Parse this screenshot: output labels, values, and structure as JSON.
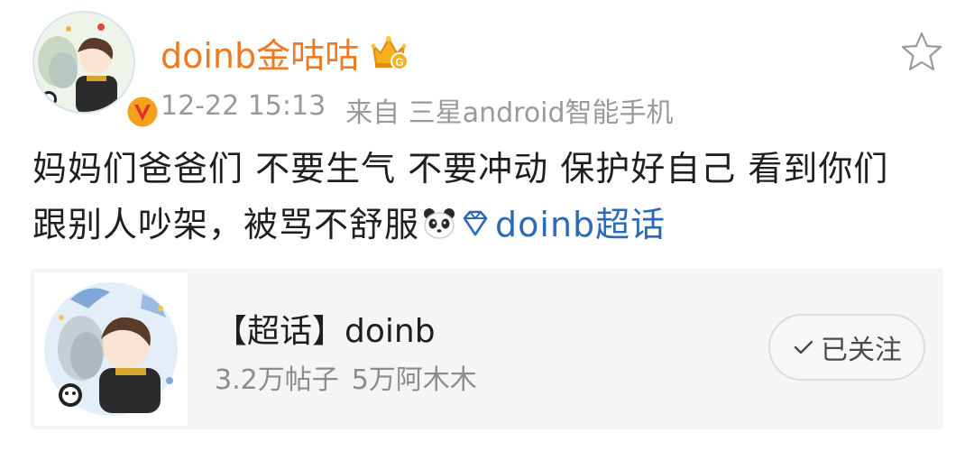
{
  "header": {
    "username": "doinb金咕咕",
    "time": "12-22 15:13",
    "source": "来自 三星android智能手机"
  },
  "post": {
    "line1": "妈妈们爸爸们 不要生气 不要冲动 保护好自己 看到你们",
    "line2": "跟别人吵架，被骂不舒服",
    "topic": "doinb超话"
  },
  "card": {
    "title": "【超话】doinb",
    "posts": "3.2万帖子",
    "followers": "5万阿木木",
    "follow_label": "已关注"
  },
  "colors": {
    "username": "#ee7a22",
    "link": "#2a6ab8",
    "meta": "#9a9a9a",
    "card_bg": "#f5f5f5"
  },
  "icons": [
    "crown-vip-icon",
    "star-icon",
    "panda-emoji-icon",
    "diamond-icon",
    "check-icon",
    "verified-badge-icon"
  ]
}
